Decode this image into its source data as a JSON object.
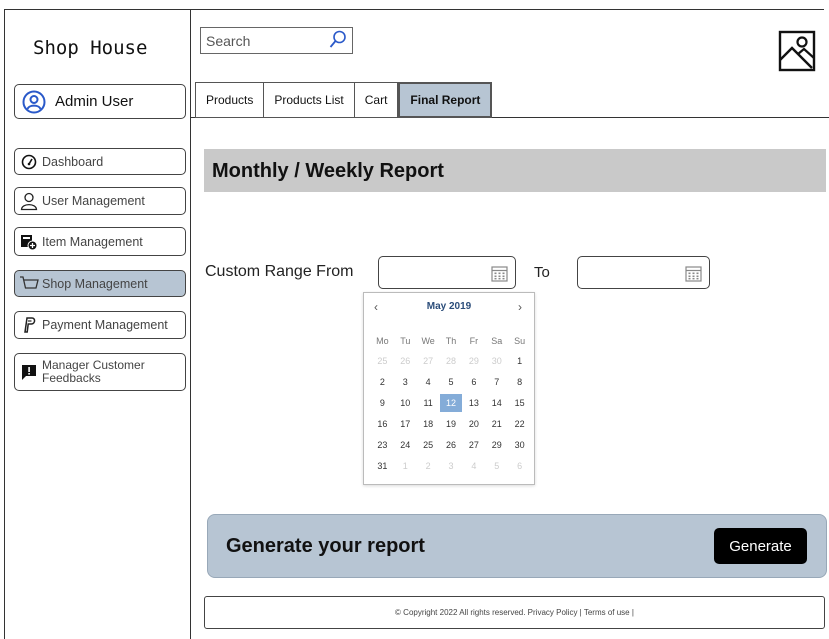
{
  "app": {
    "title": "Shop House"
  },
  "sidebar": {
    "user": {
      "label": "Admin User",
      "icon": "user-circle-icon"
    },
    "items": [
      {
        "label": "Dashboard",
        "icon": "dashboard-icon",
        "active": false
      },
      {
        "label": "User Management",
        "icon": "user-icon",
        "active": false
      },
      {
        "label": "Item Management",
        "icon": "item-management-icon",
        "active": false
      },
      {
        "label": "Shop Management",
        "icon": "cart-icon",
        "active": true
      },
      {
        "label": "Payment Management",
        "icon": "paypal-icon",
        "active": false
      },
      {
        "label": "Manager Customer Feedbacks",
        "icon": "feedback-icon",
        "active": false
      }
    ]
  },
  "header": {
    "search": {
      "placeholder": "Search",
      "value": ""
    },
    "tabs": [
      {
        "label": "Products",
        "active": false
      },
      {
        "label": "Products List",
        "active": false
      },
      {
        "label": "Cart",
        "active": false
      },
      {
        "label": "Final Report",
        "active": true
      }
    ]
  },
  "report": {
    "title": "Monthly / Weekly Report",
    "range_label": "Custom Range From",
    "to_label": "To",
    "from_value": "",
    "to_value": ""
  },
  "calendar": {
    "month": "May 2019",
    "prev": "‹",
    "next": "›",
    "weekdays": [
      "Mo",
      "Tu",
      "We",
      "Th",
      "Fr",
      "Sa",
      "Su"
    ],
    "selected": 12,
    "weeks": [
      [
        {
          "d": "25",
          "m": true
        },
        {
          "d": "26",
          "m": true
        },
        {
          "d": "27",
          "m": true
        },
        {
          "d": "28",
          "m": true
        },
        {
          "d": "29",
          "m": true
        },
        {
          "d": "30",
          "m": true
        },
        {
          "d": "1",
          "m": false
        }
      ],
      [
        {
          "d": "2",
          "m": false
        },
        {
          "d": "3",
          "m": false
        },
        {
          "d": "4",
          "m": false
        },
        {
          "d": "5",
          "m": false
        },
        {
          "d": "6",
          "m": false
        },
        {
          "d": "7",
          "m": false
        },
        {
          "d": "8",
          "m": false
        }
      ],
      [
        {
          "d": "9",
          "m": false
        },
        {
          "d": "10",
          "m": false
        },
        {
          "d": "11",
          "m": false
        },
        {
          "d": "12",
          "m": false
        },
        {
          "d": "13",
          "m": false
        },
        {
          "d": "14",
          "m": false
        },
        {
          "d": "15",
          "m": false
        }
      ],
      [
        {
          "d": "16",
          "m": false
        },
        {
          "d": "17",
          "m": false
        },
        {
          "d": "18",
          "m": false
        },
        {
          "d": "19",
          "m": false
        },
        {
          "d": "20",
          "m": false
        },
        {
          "d": "21",
          "m": false
        },
        {
          "d": "22",
          "m": false
        }
      ],
      [
        {
          "d": "23",
          "m": false
        },
        {
          "d": "24",
          "m": false
        },
        {
          "d": "25",
          "m": false
        },
        {
          "d": "26",
          "m": false
        },
        {
          "d": "27",
          "m": false
        },
        {
          "d": "29",
          "m": false
        },
        {
          "d": "30",
          "m": false
        }
      ],
      [
        {
          "d": "31",
          "m": false
        },
        {
          "d": "1",
          "m": true
        },
        {
          "d": "2",
          "m": true
        },
        {
          "d": "3",
          "m": true
        },
        {
          "d": "4",
          "m": true
        },
        {
          "d": "5",
          "m": true
        },
        {
          "d": "6",
          "m": true
        }
      ]
    ]
  },
  "generate": {
    "title": "Generate your report",
    "button": "Generate"
  },
  "footer": {
    "text": "© Copyright 2022 All rights reserved. Privacy Policy | Terms of use |"
  },
  "colors": {
    "accent": "#b7c5d3",
    "header_band": "#c9c9c9",
    "selected_day": "#84acd8",
    "button": "#000000"
  }
}
